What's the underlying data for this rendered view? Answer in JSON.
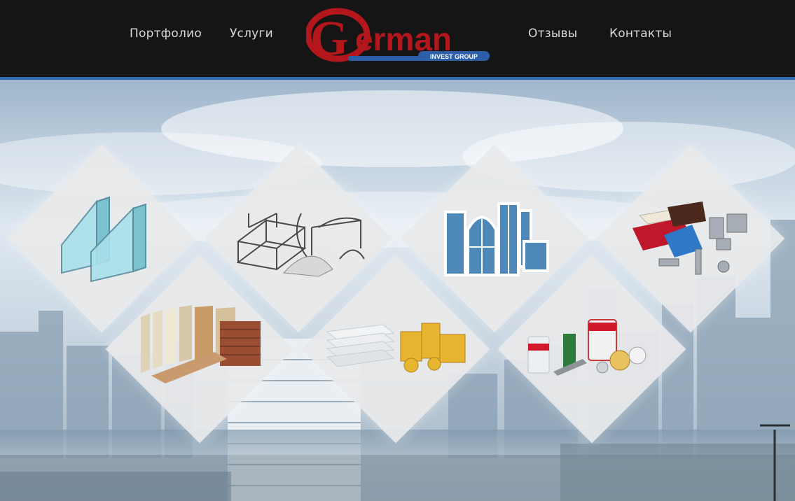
{
  "nav": {
    "left": [
      {
        "label": "Портфолио"
      },
      {
        "label": "Услуги"
      }
    ],
    "right": [
      {
        "label": "Отзывы"
      },
      {
        "label": "Контакты"
      }
    ]
  },
  "logo": {
    "text": "German",
    "tagline": "INVEST GROUP",
    "colors": {
      "red": "#b3161b",
      "blue": "#2d5fa8"
    }
  },
  "tiles": [
    {
      "icon": "double-glazing-icon"
    },
    {
      "icon": "metal-structures-icon"
    },
    {
      "icon": "windows-icon"
    },
    {
      "icon": "roofing-gutters-icon"
    },
    {
      "icon": "facade-siding-icon"
    },
    {
      "icon": "insulation-icon"
    },
    {
      "icon": "dry-mixes-icon"
    }
  ],
  "colors": {
    "header_bg": "#151515",
    "accent_line": "#2f6db0",
    "nav_text": "#d9d9d9"
  }
}
